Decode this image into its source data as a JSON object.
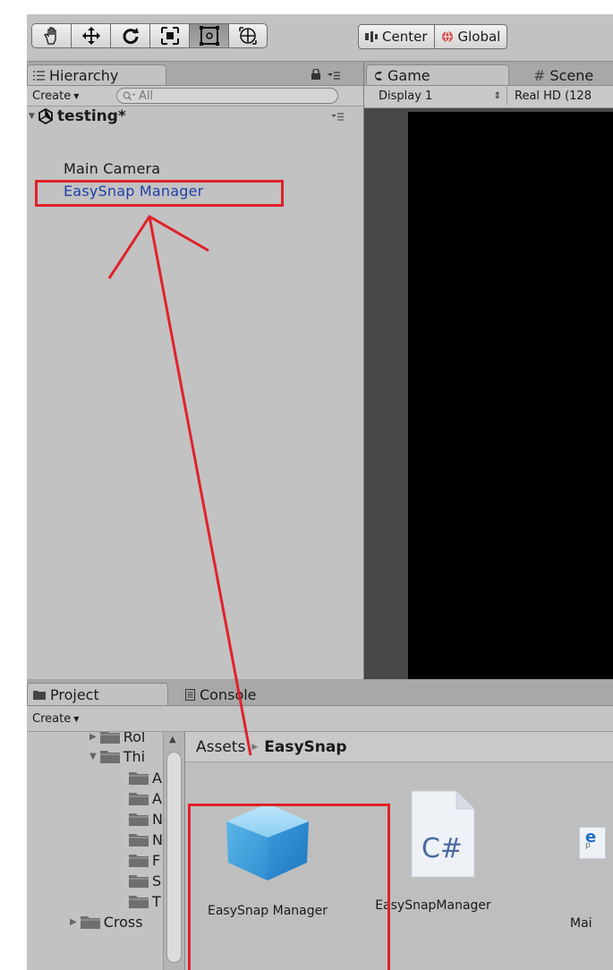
{
  "toolbar": {
    "tools": [
      {
        "icon": "hand-icon"
      },
      {
        "icon": "move-icon"
      },
      {
        "icon": "rotate-icon"
      },
      {
        "icon": "scale-icon"
      },
      {
        "icon": "rect-tool-icon",
        "active": true
      },
      {
        "icon": "transform-tool-icon"
      }
    ],
    "pivot_label": "Center",
    "space_label": "Global"
  },
  "hierarchy": {
    "tab_label": "Hierarchy",
    "create_label": "Create",
    "search_placeholder": "All",
    "scene_name": "testing*",
    "items": [
      "Main Camera",
      "EasySnap Manager"
    ],
    "selected_index": 1
  },
  "game_view": {
    "tabs": [
      "Game",
      "Scene"
    ],
    "display_label": "Display 1",
    "resolution_label": "Real HD (128"
  },
  "project": {
    "tabs": [
      "Project",
      "Console"
    ],
    "create_label": "Create",
    "tree": [
      {
        "label": "Rol",
        "expanded": false,
        "indent": 1
      },
      {
        "label": "Thi",
        "expanded": true,
        "indent": 1
      },
      {
        "label": "A",
        "indent": 2
      },
      {
        "label": "A",
        "indent": 2
      },
      {
        "label": "N",
        "indent": 2
      },
      {
        "label": "N",
        "indent": 2
      },
      {
        "label": "F",
        "indent": 2
      },
      {
        "label": "S",
        "indent": 2
      },
      {
        "label": "T",
        "indent": 2
      },
      {
        "label": "Cross",
        "expanded": false,
        "indent": 0
      }
    ],
    "breadcrumb": {
      "root": "Assets",
      "current": "EasySnap"
    },
    "assets": [
      {
        "name": "EasySnap Manager",
        "type": "prefab"
      },
      {
        "name": "EasySnapManager",
        "type": "script",
        "glyph": "C#"
      },
      {
        "name": "Mai",
        "type": "other",
        "glyph": "e",
        "sub": "p"
      }
    ]
  },
  "colors": {
    "highlight": "#e0222a",
    "selected_text": "#1f3fa8",
    "prefab_blue": "#4aa8e0"
  }
}
